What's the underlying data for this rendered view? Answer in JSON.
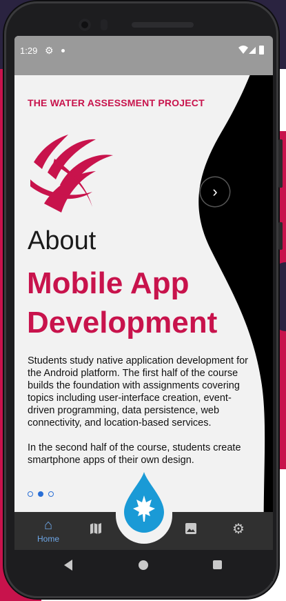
{
  "status_bar": {
    "time": "1:29",
    "settings_icon": "gear-icon",
    "notification_dot": "dot-icon",
    "wifi_icon": "wifi-icon",
    "battery_icon": "battery-icon"
  },
  "content": {
    "project_title": "THE WATER ASSESSMENT PROJECT",
    "about_label": "About",
    "headline": "Mobile App Development",
    "paragraph_1": "Students study native application development for the Android platform. The first half of the course builds the foundation with assignments covering topics including user-interface creation, event-driven programming, data persistence, web connectivity, and location-based services.",
    "paragraph_2": "In the second half of the course, students create smartphone apps of their own design.",
    "next_icon": "chevron-right-icon"
  },
  "pager": {
    "pages": 3,
    "active_index": 1
  },
  "bottom_nav": {
    "items": [
      {
        "icon": "home-icon",
        "label": "Home",
        "active": true
      },
      {
        "icon": "map-icon",
        "label": "",
        "active": false
      },
      {
        "icon": "gallery-icon",
        "label": "",
        "active": false
      },
      {
        "icon": "settings-icon",
        "label": "",
        "active": false
      }
    ]
  },
  "system_nav": {
    "back_icon": "back-icon",
    "home_icon": "home-circle-icon",
    "recent_icon": "recent-apps-icon"
  },
  "colors": {
    "accent": "#c8134c",
    "pager_blue": "#2a6fd6",
    "nav_active": "#6fa8e8",
    "navbar": "#303030"
  }
}
